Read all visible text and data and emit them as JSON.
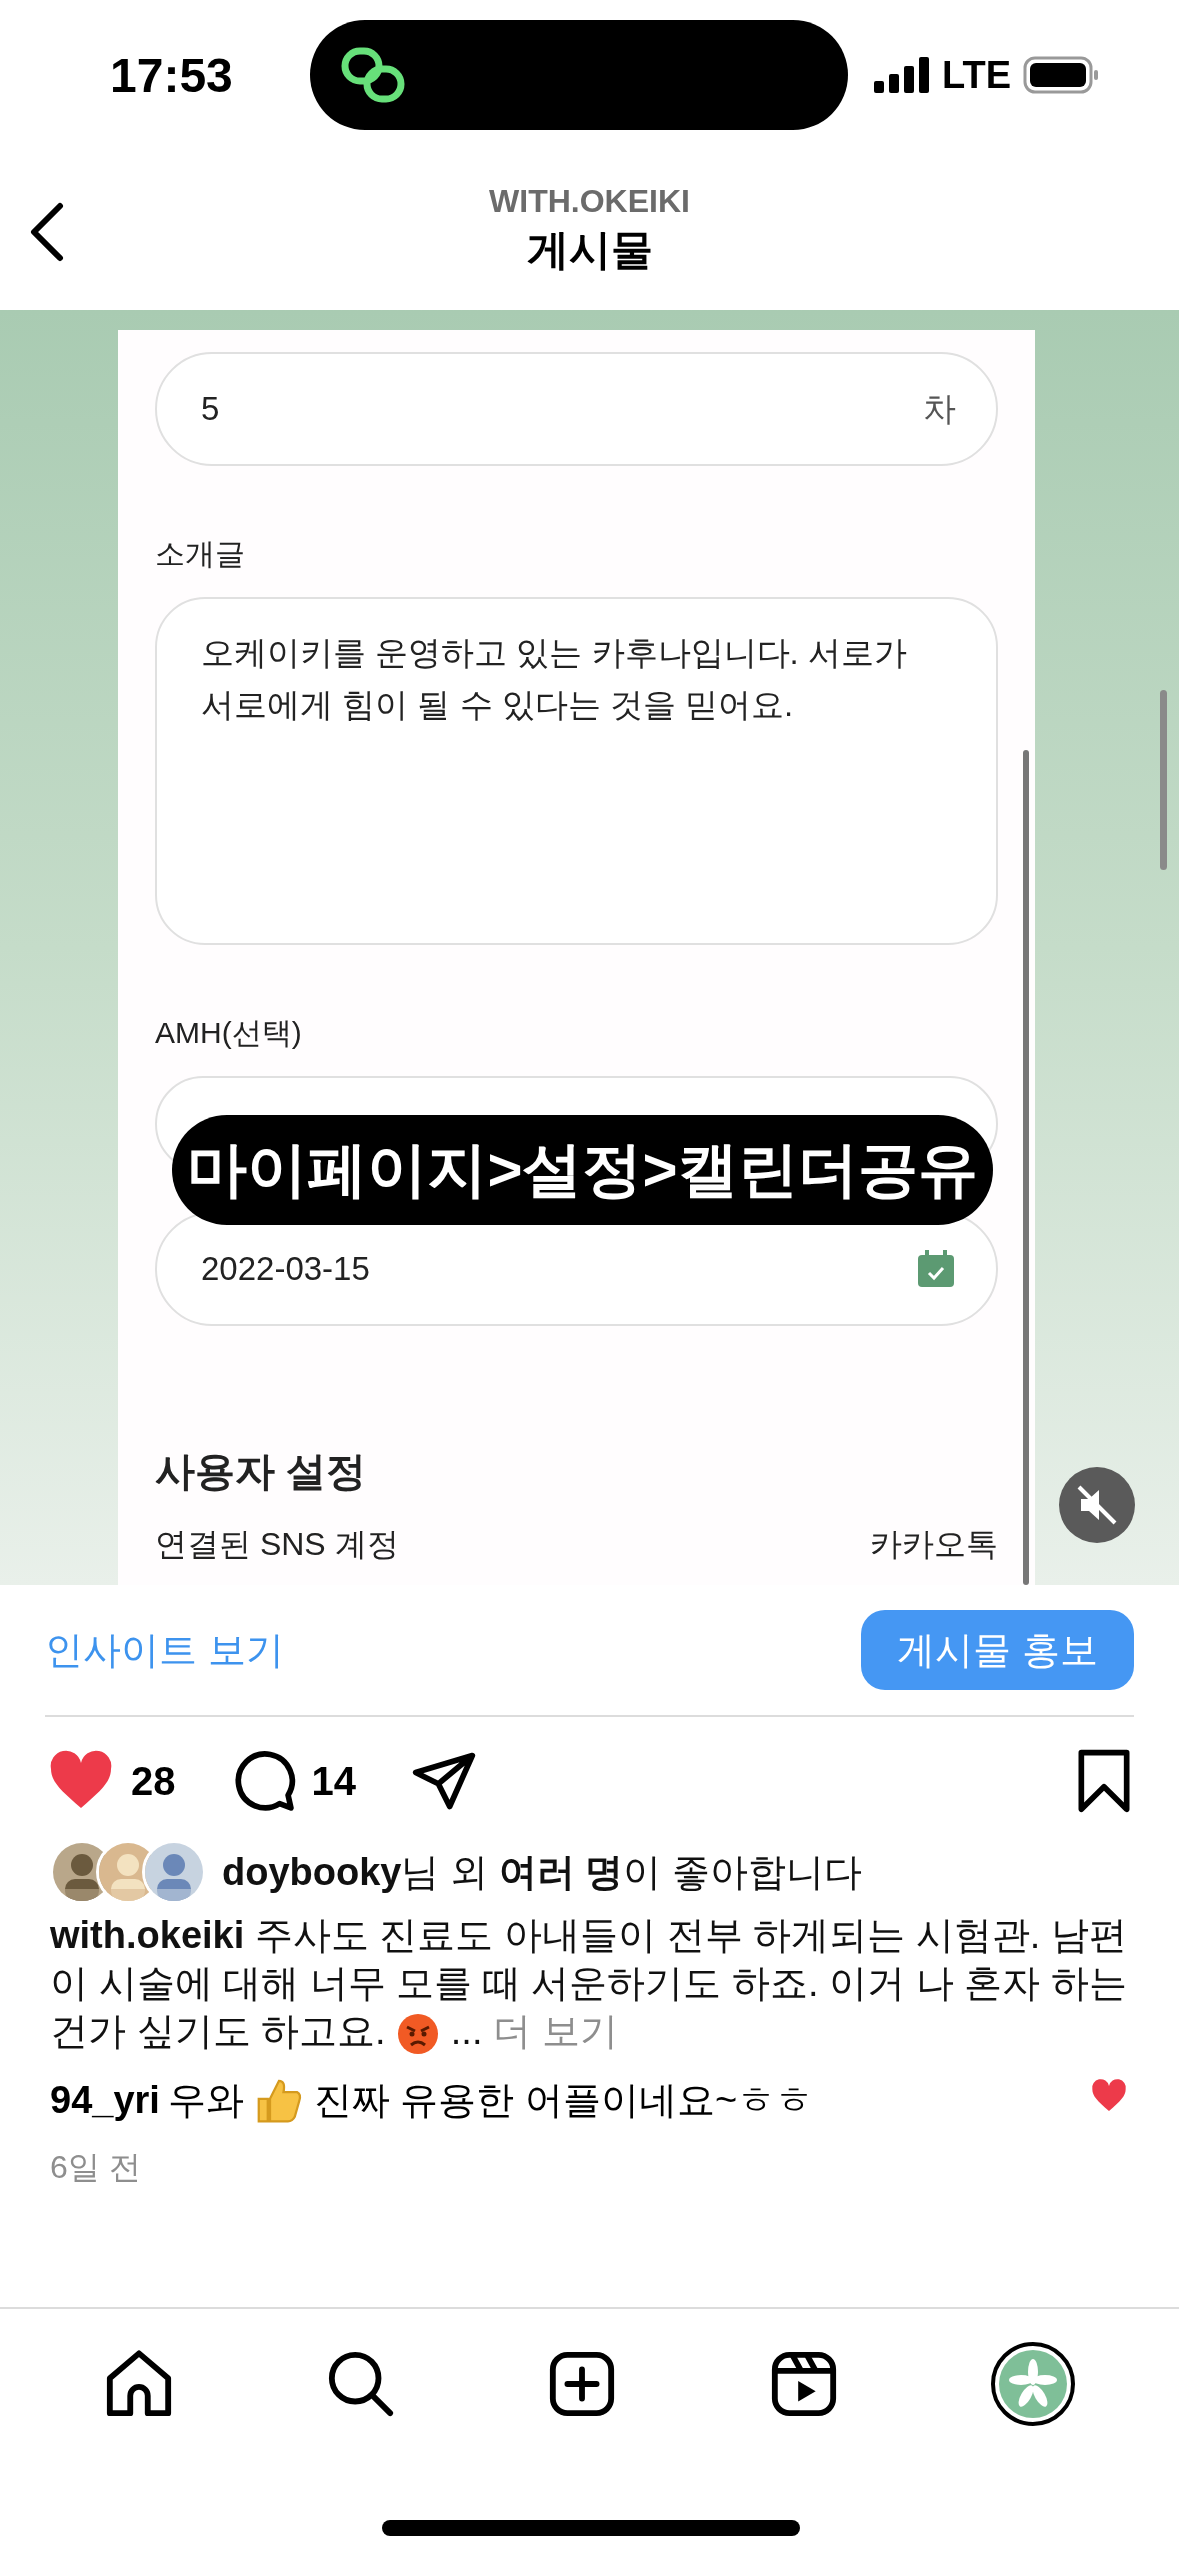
{
  "status_bar": {
    "time": "17:53",
    "network": "LTE"
  },
  "header": {
    "account": "WITH.OKEIKI",
    "title": "게시물"
  },
  "video": {
    "form": {
      "round_field": {
        "value": "5",
        "suffix": "차"
      },
      "intro": {
        "label": "소개글",
        "value": "오케이키를 운영하고 있는 카후나입니다. 서로가 서로에게 힘이 될 수 있다는 것을 믿어요."
      },
      "amh": {
        "label": "AMH(선택)"
      },
      "date_field": {
        "value": "2022-03-15"
      },
      "section_title": "사용자 설정",
      "sns_row": {
        "label": "연결된 SNS 계정",
        "value": "카카오톡"
      }
    },
    "caption_overlay": "마이페이지>설정>캘린더공유",
    "muted": true
  },
  "insights": {
    "link": "인사이트 보기",
    "promote_button": "게시물 홍보"
  },
  "actions": {
    "liked": true,
    "likes": "28",
    "comments": "14",
    "saved": false
  },
  "liked_by": "**doybooky**님 외 **여러 명**이 좋아합니다",
  "caption": {
    "text": "**with.okeiki** 주사도 진료도 아내들이 전부 하게되는 시험관. 남편이 시술에 대해 너무 모를 때 서운하기도 하죠. 이거 나 혼자 하는 건가 싶기도 하고요.",
    "ellipsis": "...",
    "more": "더 보기"
  },
  "comments": [
    {
      "user": "94_yri",
      "text_before": "우와",
      "text_after": "진짜 유용한 어플이네요~ㅎㅎ",
      "liked": true
    }
  ],
  "time_ago": "6일 전"
}
